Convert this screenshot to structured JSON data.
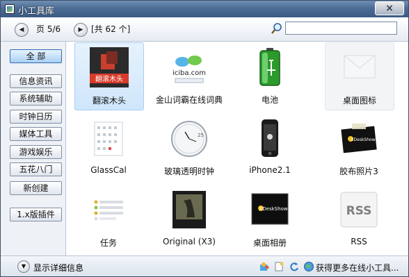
{
  "window": {
    "title": "小工具库",
    "close_glyph": "×"
  },
  "toolbar": {
    "prev_icon": "chevron-left-icon",
    "next_icon": "chevron-right-icon",
    "page_label": "页 5/6",
    "total_label": "[共 62 个]",
    "search_placeholder": "",
    "search_icon": "magnifier-icon"
  },
  "sidebar": {
    "items": [
      {
        "label": "全  部",
        "active": true
      },
      {
        "label": "信息资讯"
      },
      {
        "label": "系统辅助"
      },
      {
        "label": "时钟日历"
      },
      {
        "label": "媒体工具"
      },
      {
        "label": "游戏娱乐"
      },
      {
        "label": "五花八门"
      },
      {
        "label": "新创建"
      },
      {
        "label": "1.x版插件"
      }
    ]
  },
  "gadgets": [
    {
      "label": "翻滚木头",
      "thumb_text": "翻滚木头",
      "icon": "rolling-wood-icon",
      "selected": true
    },
    {
      "label": "金山词霸在线词典",
      "thumb_text": "iciba.com",
      "icon": "iciba-dictionary-icon"
    },
    {
      "label": "电池",
      "icon": "battery-icon"
    },
    {
      "label": "桌面图标",
      "icon": "desktop-icons-icon",
      "ghost": true
    },
    {
      "label": "GlassCal",
      "icon": "calendar-icon"
    },
    {
      "label": "玻璃透明时钟",
      "thumb_text": "25",
      "icon": "clock-icon"
    },
    {
      "label": "iPhone2.1",
      "icon": "iphone-icon"
    },
    {
      "label": "胶布照片3",
      "thumb_text": "XDeskShow",
      "icon": "tape-photo-icon"
    },
    {
      "label": "任务",
      "icon": "task-list-icon"
    },
    {
      "label": "Original (X3)",
      "icon": "original-photo-icon"
    },
    {
      "label": "桌面相册",
      "thumb_text": "XDeskShow",
      "icon": "desktop-album-icon"
    },
    {
      "label": "RSS",
      "thumb_text": "RSS",
      "icon": "rss-icon"
    }
  ],
  "status": {
    "expand_label": "显示详细信息",
    "more_label": "获得更多在线小工具...",
    "icons": [
      "puzzle-icon",
      "new-document-icon",
      "refresh-icon",
      "globe-icon"
    ]
  },
  "colors": {
    "accent": "#2f6bb7",
    "titlebar": "#4d6d96"
  }
}
